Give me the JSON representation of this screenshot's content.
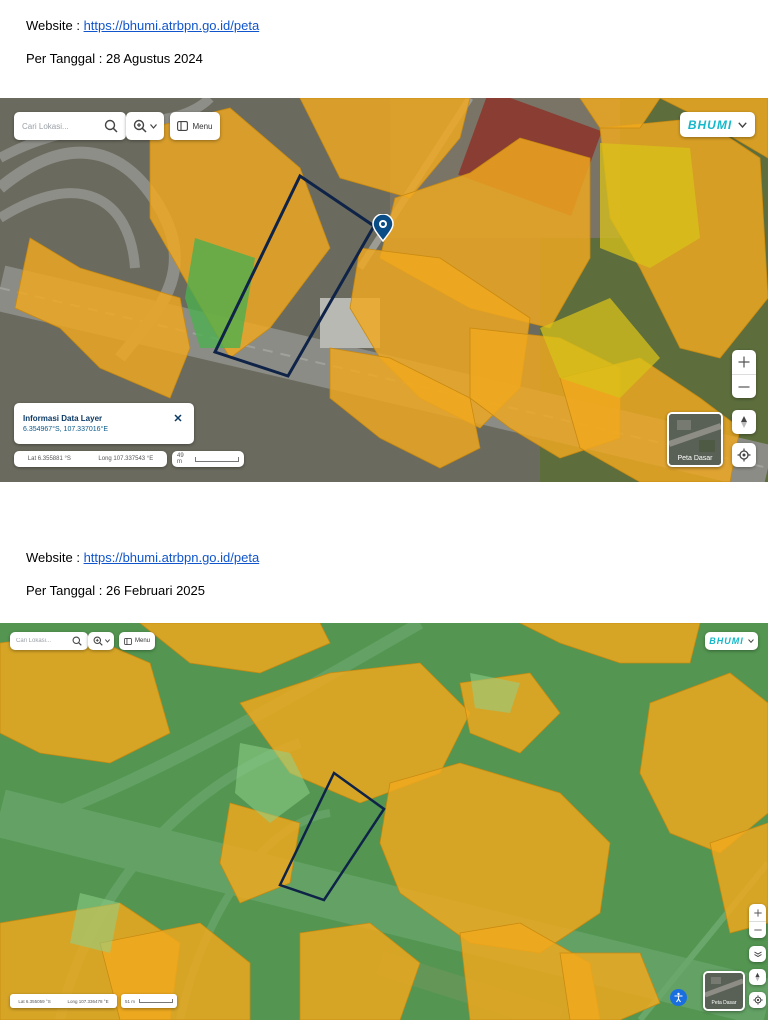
{
  "sections": [
    {
      "website_prefix": "Website : ",
      "website_url": "https://bhumi.atrbpn.go.id/peta",
      "date_line": "Per Tanggal : 28 Agustus 2024",
      "map": {
        "search_placeholder": "Cari Lokasi...",
        "menu_label": "Menu",
        "brand": "BHUMI",
        "info_title": "Informasi Data Layer",
        "info_coords": "6.354967°S, 107.337016°E",
        "lat": "Lat 6.355881 °S",
        "long": "Long 107.337543 °E",
        "scale": "49 m",
        "basemap_label": "Peta Dasar",
        "search_icon": "search-icon",
        "zoom_icon": "zoom-select-icon",
        "menu_icon": "panel-icon",
        "close_icon": "close-icon",
        "zoom_in_icon": "plus-icon",
        "zoom_out_icon": "minus-icon",
        "compass_icon": "compass-icon",
        "locate_icon": "locate-icon",
        "marker_icon": "location-pin-icon"
      }
    },
    {
      "website_prefix": "Website : ",
      "website_url": "https://bhumi.atrbpn.go.id/peta",
      "date_line": "Per Tanggal : 26 Februari 2025",
      "map": {
        "search_placeholder": "Cari Lokasi...",
        "menu_label": "Menu",
        "brand": "BHUMI",
        "lat": "Lat 6.355059 °S",
        "long": "Long 107.336478 °E",
        "scale": "51 m",
        "basemap_label": "Peta Dasar",
        "search_icon": "search-icon",
        "zoom_icon": "zoom-select-icon",
        "menu_icon": "panel-icon",
        "zoom_in_icon": "plus-icon",
        "zoom_out_icon": "minus-icon",
        "layers_icon": "layers-icon",
        "compass_icon": "compass-icon",
        "locate_icon": "locate-icon",
        "accessibility_icon": "accessibility-icon"
      }
    }
  ],
  "colors": {
    "parcel_orange": "#f0a81e",
    "parcel_green": "#4cb050",
    "parcel_yellow": "#d8c21a",
    "outline_navy": "#0e2347",
    "marker_blue": "#0a4c86",
    "link_blue": "#1155cc",
    "brand_cyan": "#14b8c9"
  }
}
